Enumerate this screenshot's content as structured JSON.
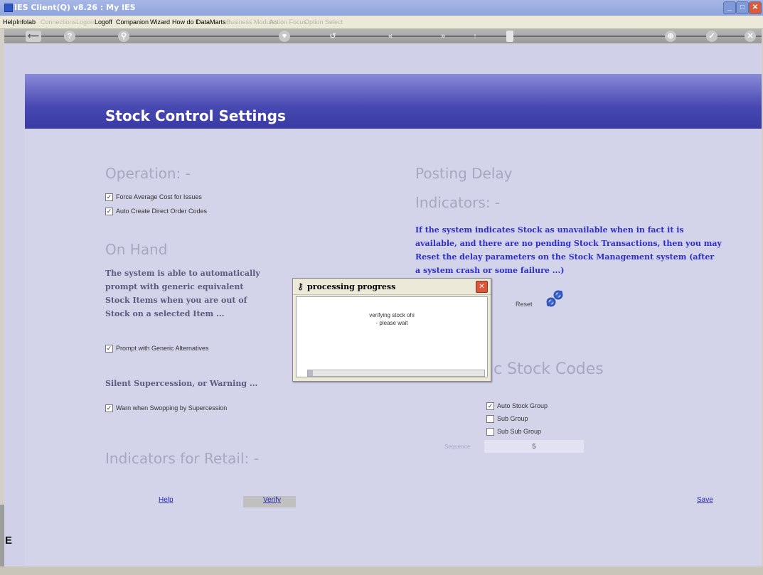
{
  "window": {
    "title": "IES Client(Q) v8.26 : My IES"
  },
  "menu": {
    "items": [
      {
        "label": "Help",
        "enabled": true
      },
      {
        "label": "Infolab",
        "enabled": true
      },
      {
        "label": "Connections",
        "enabled": false
      },
      {
        "label": "Logon",
        "enabled": false
      },
      {
        "label": "Logoff",
        "enabled": true
      },
      {
        "label": "Companion",
        "enabled": true
      },
      {
        "label": "Wizard",
        "enabled": true
      },
      {
        "label": "How do I",
        "enabled": true
      },
      {
        "label": "DataMarts",
        "enabled": true
      },
      {
        "label": "Business Modules",
        "enabled": false
      },
      {
        "label": "Action Focus",
        "enabled": false
      },
      {
        "label": "Option Select",
        "enabled": false
      }
    ]
  },
  "toolbar": {
    "icons": [
      "back-icon",
      "help-icon",
      "search-icon",
      "heart-icon",
      "refresh-icon",
      "rewind-icon",
      "forward-icon",
      "nav-icon",
      "stop-icon",
      "zoom-icon",
      "check-icon",
      "close-icon"
    ]
  },
  "page": {
    "title": "Stock Control Settings"
  },
  "operation": {
    "heading": "Operation: -",
    "options": [
      {
        "label": "Force Average Cost for Issues",
        "checked": true
      },
      {
        "label": "Auto Create Direct Order Codes",
        "checked": true
      }
    ]
  },
  "on_hand": {
    "heading": "On Hand",
    "text_lines": [
      "The system is able to automatically",
      "prompt with generic equivalent",
      "Stock Items when you are out of",
      "Stock on a selected Item ..."
    ],
    "prompt_option": {
      "label": "Prompt with Generic Alternatives",
      "checked": true
    },
    "supercession_text": "Silent Supercession, or Warning ...",
    "warn_option": {
      "label": "Warn when Swopping by Supercession",
      "checked": true
    }
  },
  "retail": {
    "heading": "Indicators for Retail: -"
  },
  "posting_delay": {
    "heading1": "Posting Delay",
    "heading2": "Indicators: -",
    "text_lines": [
      "If the system indicates Stock as unavailable when in fact it is",
      "available, and there are no pending Stock Transactions, then you may",
      "Reset the delay parameters on the  Stock Management system (after",
      "a system crash or some failure ...)"
    ],
    "reset_label": "Reset"
  },
  "stock_codes": {
    "heading": "c Stock Codes",
    "options": [
      {
        "label": "Auto Stock Group",
        "checked": true
      },
      {
        "label": "Sub Group",
        "checked": false
      },
      {
        "label": "Sub Sub Group",
        "checked": false
      }
    ],
    "sequence_label": "Sequence",
    "sequence_value": "5"
  },
  "footer": {
    "help": "Help",
    "verify": "Verify",
    "save": "Save"
  },
  "dialog": {
    "title": "processing progress",
    "message_line1": "verifying stock ohi",
    "message_line2": "- please wait",
    "progress": 0.03
  },
  "left_glyph": "E"
}
